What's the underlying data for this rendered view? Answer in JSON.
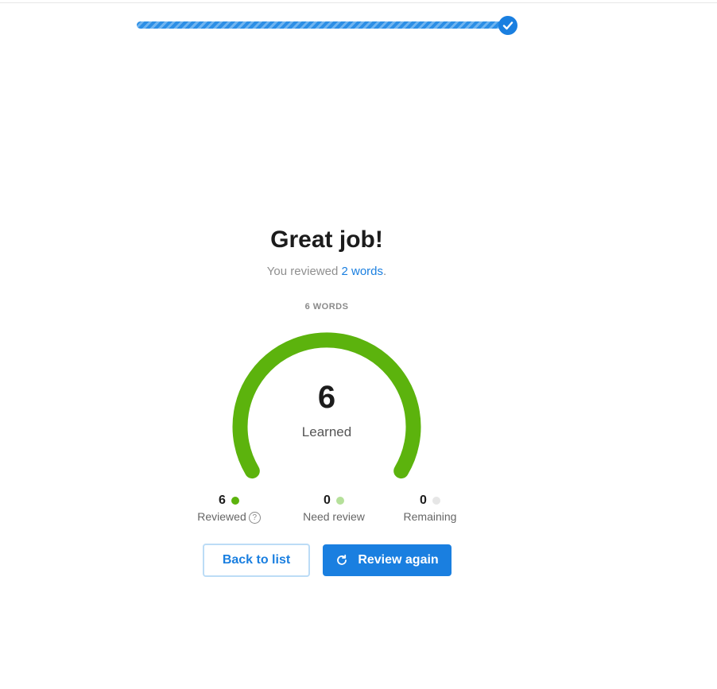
{
  "progress": {
    "value": 1.0,
    "complete_icon": "check-icon",
    "color": "#2d8fe6"
  },
  "summary": {
    "title": "Great job!",
    "subtitle_prefix": "You reviewed ",
    "subtitle_link": "2 words",
    "subtitle_suffix": ".",
    "total_label": "6 WORDS"
  },
  "gauge": {
    "value": "6",
    "caption": "Learned",
    "fraction": 1.0,
    "color": "#5cb30d"
  },
  "stats": [
    {
      "value": "6",
      "label": "Reviewed",
      "dot_color": "#5cb30d",
      "help_icon": "question-icon",
      "help_glyph": "?"
    },
    {
      "value": "0",
      "label": "Need review",
      "dot_color": "#b5e09a"
    },
    {
      "value": "0",
      "label": "Remaining",
      "dot_color": "#e6e6e6"
    }
  ],
  "actions": {
    "back_label": "Back to list",
    "again_label": "Review again",
    "again_icon": "refresh-icon"
  }
}
